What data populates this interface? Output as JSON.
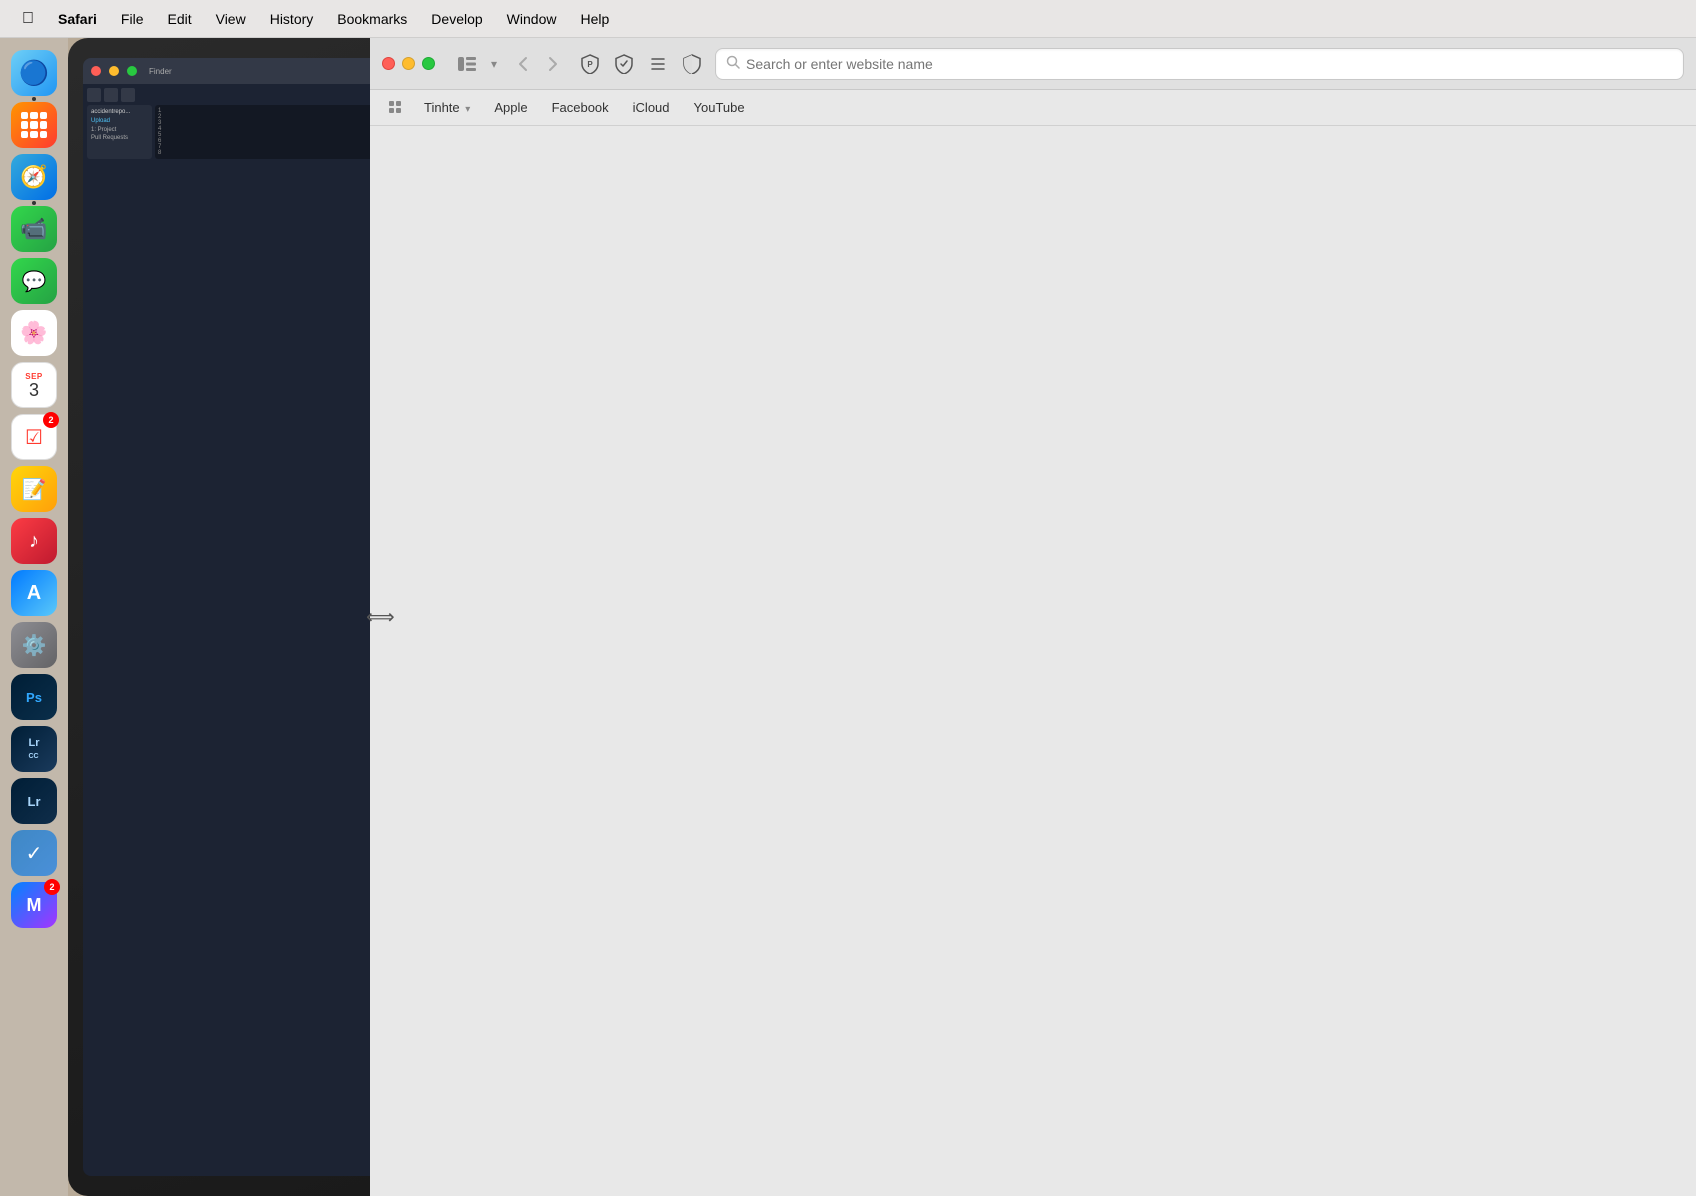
{
  "menubar": {
    "apple": "",
    "items": [
      "Safari",
      "File",
      "Edit",
      "View",
      "History",
      "Bookmarks",
      "Develop",
      "Window",
      "Help"
    ]
  },
  "dock": {
    "items": [
      {
        "id": "finder",
        "label": "Finder",
        "icon": "🔵",
        "has_dot": true,
        "badge": null
      },
      {
        "id": "launchpad",
        "label": "Launchpad",
        "icon": "⊞",
        "has_dot": false,
        "badge": null
      },
      {
        "id": "safari",
        "label": "Safari",
        "icon": "🧭",
        "has_dot": true,
        "badge": null
      },
      {
        "id": "facetime",
        "label": "FaceTime",
        "icon": "📹",
        "has_dot": false,
        "badge": null
      },
      {
        "id": "messages",
        "label": "Messages",
        "icon": "💬",
        "has_dot": false,
        "badge": null
      },
      {
        "id": "photos",
        "label": "Photos",
        "icon": "🌸",
        "has_dot": false,
        "badge": null
      },
      {
        "id": "calendar",
        "label": "Calendar",
        "icon": "3",
        "has_dot": false,
        "badge": null
      },
      {
        "id": "reminders",
        "label": "Reminders",
        "icon": "✓",
        "has_dot": false,
        "badge": "2"
      },
      {
        "id": "notes",
        "label": "Notes",
        "icon": "📝",
        "has_dot": false,
        "badge": null
      },
      {
        "id": "music",
        "label": "Music",
        "icon": "♪",
        "has_dot": false,
        "badge": null
      },
      {
        "id": "appstore",
        "label": "App Store",
        "icon": "A",
        "has_dot": false,
        "badge": null
      },
      {
        "id": "settings",
        "label": "System Preferences",
        "icon": "⚙",
        "has_dot": false,
        "badge": null
      },
      {
        "id": "photoshop",
        "label": "Photoshop",
        "icon": "Ps",
        "has_dot": false,
        "badge": null
      },
      {
        "id": "lightroom-cc",
        "label": "Lightroom CC",
        "icon": "Lr",
        "has_dot": false,
        "badge": null
      },
      {
        "id": "lightroom",
        "label": "Lightroom Classic",
        "icon": "Lr",
        "has_dot": false,
        "badge": null
      },
      {
        "id": "things",
        "label": "Things",
        "icon": "✓",
        "has_dot": false,
        "badge": null
      },
      {
        "id": "messenger",
        "label": "Messenger",
        "icon": "M",
        "has_dot": false,
        "badge": "2"
      }
    ]
  },
  "safari": {
    "address_bar": {
      "placeholder": "Search or enter website name",
      "value": ""
    },
    "bookmarks": [
      {
        "id": "tinhte",
        "label": "Tinhte",
        "has_dropdown": true
      },
      {
        "id": "apple",
        "label": "Apple",
        "has_dropdown": false
      },
      {
        "id": "facebook",
        "label": "Facebook",
        "has_dropdown": false
      },
      {
        "id": "icloud",
        "label": "iCloud",
        "has_dropdown": false
      },
      {
        "id": "youtube",
        "label": "YouTube",
        "has_dropdown": false
      }
    ],
    "toolbar": {
      "back": "‹",
      "forward": "›",
      "shield1": "🛡",
      "shield2": "🛡",
      "lines": "☰",
      "half_shield": "⬡"
    }
  },
  "resize_cursor": "⟺"
}
